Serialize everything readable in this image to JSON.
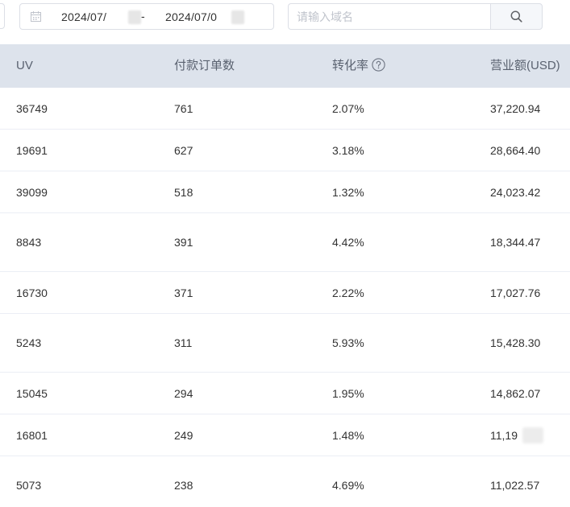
{
  "toolbar": {
    "date_start": "2024/07/",
    "date_separator": "-",
    "date_end": "2024/07/0",
    "domain_placeholder": "请输入域名",
    "calendar_icon": "calendar-icon",
    "search_icon": "search-icon"
  },
  "table": {
    "headers": {
      "uv": "UV",
      "orders": "付款订单数",
      "rate": "转化率",
      "revenue": "营业额(USD)"
    },
    "rows": [
      {
        "uv": "36749",
        "orders": "761",
        "rate": "2.07%",
        "revenue": "37,220.94"
      },
      {
        "uv": "19691",
        "orders": "627",
        "rate": "3.18%",
        "revenue": "28,664.40"
      },
      {
        "uv": "39099",
        "orders": "518",
        "rate": "1.32%",
        "revenue": "24,023.42"
      },
      {
        "uv": "8843",
        "orders": "391",
        "rate": "4.42%",
        "revenue": "18,344.47"
      },
      {
        "uv": "16730",
        "orders": "371",
        "rate": "2.22%",
        "revenue": "17,027.76"
      },
      {
        "uv": "5243",
        "orders": "311",
        "rate": "5.93%",
        "revenue": "15,428.30"
      },
      {
        "uv": "15045",
        "orders": "294",
        "rate": "1.95%",
        "revenue": "14,862.07"
      },
      {
        "uv": "16801",
        "orders": "249",
        "rate": "1.48%",
        "revenue": "11,19"
      },
      {
        "uv": "5073",
        "orders": "238",
        "rate": "4.69%",
        "revenue": "11,022.57"
      }
    ]
  },
  "colors": {
    "header_bg": "#dde3ec",
    "border": "#dcdfe6",
    "text": "#333333",
    "placeholder": "#c0c4cc"
  }
}
